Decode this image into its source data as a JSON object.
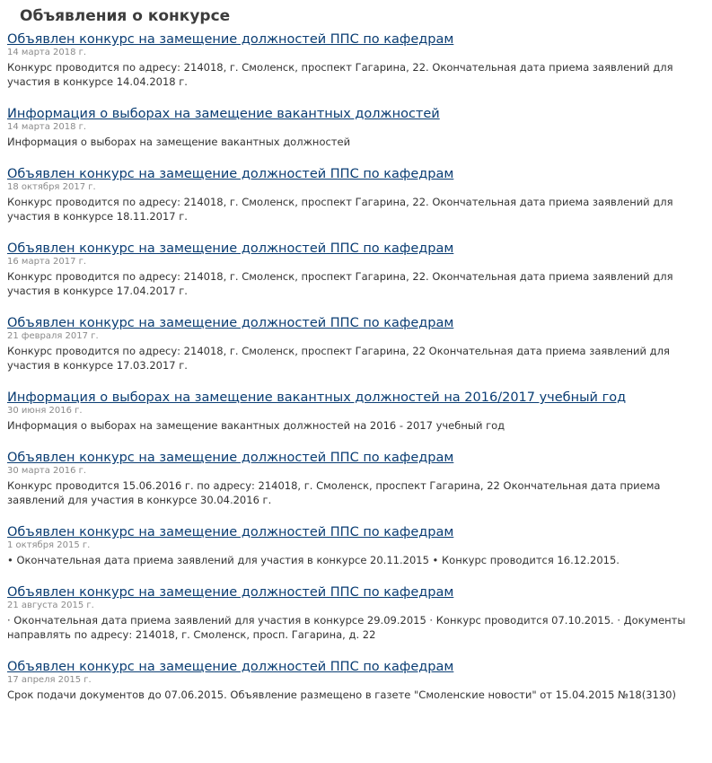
{
  "page": {
    "title": "Объявления о конкурсе"
  },
  "news": [
    {
      "title": "Объявлен конкурс на замещение должностей ППС по кафедрам",
      "date": "14 марта 2018 г.",
      "description": "Конкурс проводится по адресу: 214018, г. Смоленск, проспект Гагарина, 22. Окончательная дата приема заявлений для участия в конкурсе 14.04.2018 г."
    },
    {
      "title": "Информация о выборах на замещение вакантных должностей",
      "date": "14 марта 2018 г.",
      "description": "Информация о выборах на замещение вакантных должностей"
    },
    {
      "title": "Объявлен конкурс на замещение должностей ППС по кафедрам",
      "date": "18 октября 2017 г.",
      "description": "Конкурс проводится по адресу: 214018, г. Смоленск, проспект Гагарина, 22. Окончательная дата приема заявлений для участия в конкурсе 18.11.2017 г."
    },
    {
      "title": "Объявлен конкурс на замещение должностей ППС по кафедрам",
      "date": "16 марта 2017 г.",
      "description": "Конкурс проводится по адресу: 214018, г. Смоленск, проспект Гагарина, 22. Окончательная дата приема заявлений для участия в конкурсе 17.04.2017 г."
    },
    {
      "title": "Объявлен конкурс на замещение должностей ППС по кафедрам",
      "date": "21 февраля 2017 г.",
      "description": "Конкурс проводится по адресу: 214018, г. Смоленск, проспект Гагарина, 22 Окончательная дата приема заявлений для участия в конкурсе 17.03.2017 г."
    },
    {
      "title": "Информация о выборах на замещение вакантных должностей на 2016/2017 учебный год",
      "date": "30 июня 2016 г.",
      "description": "Информация о выборах на замещение вакантных должностей на 2016 - 2017 учебный год"
    },
    {
      "title": "Объявлен конкурс на замещение должностей ППС по кафедрам",
      "date": "30 марта 2016 г.",
      "description": "Конкурс проводится 15.06.2016 г. по адресу: 214018, г. Смоленск, проспект Гагарина, 22 Окончательная дата приема заявлений для участия в конкурсе 30.04.2016 г."
    },
    {
      "title": "Объявлен конкурс на замещение должностей ППС по кафедрам",
      "date": "1 октября 2015 г.",
      "description": "• Окончательная дата приема заявлений для участия в конкурсе 20.11.2015 • Конкурс проводится 16.12.2015."
    },
    {
      "title": "Объявлен конкурс на замещение должностей ППС по кафедрам",
      "date": "21 августа 2015 г.",
      "description": "· Окончательная дата приема заявлений для участия в конкурсе 29.09.2015 · Конкурс проводится 07.10.2015. · Документы направлять по адресу: 214018, г. Смоленск, просп. Гагарина, д. 22"
    },
    {
      "title": "Объявлен конкурс на замещение должностей ППС по кафедрам",
      "date": "17 апреля 2015 г.",
      "description": "Срок подачи документов до 07.06.2015. Объявление размещено в газете \"Смоленские новости\" от 15.04.2015 №18(3130)"
    }
  ]
}
